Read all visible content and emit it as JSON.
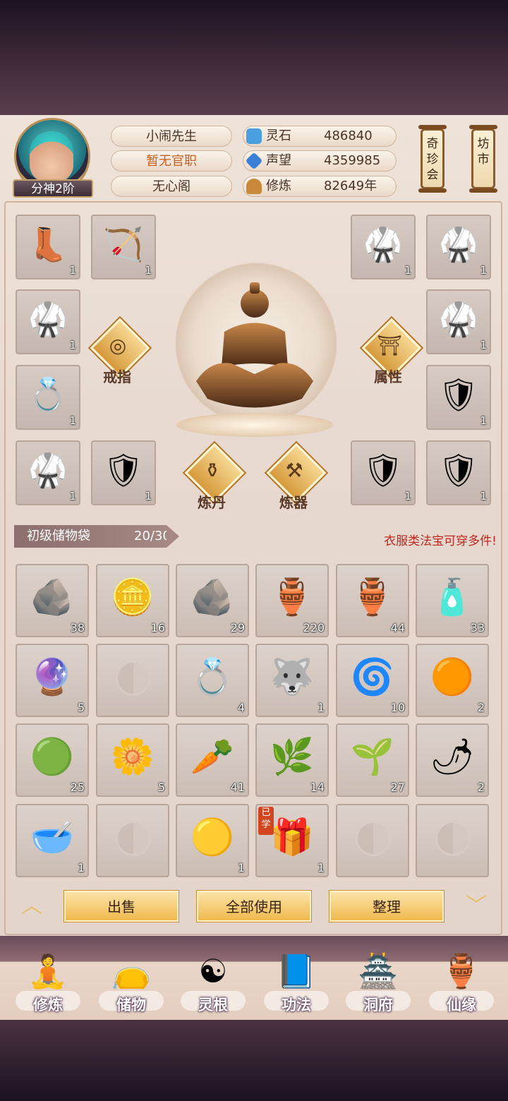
{
  "header": {
    "rank_badge": "分神2阶",
    "player_name": "小闹先生",
    "official_title": "暂无官职",
    "sect": "无心阁",
    "resources": [
      {
        "label": "灵石",
        "value": "486840",
        "icon": "spirit-stone-icon",
        "color": "#4a9fe0"
      },
      {
        "label": "声望",
        "value": "4359985",
        "icon": "crystal-icon",
        "color": "#3b7fd6"
      },
      {
        "label": "修炼",
        "value": "82649年",
        "icon": "meditation-icon",
        "color": "#c88a3a"
      }
    ],
    "side_buttons": [
      {
        "label": "奇珍会"
      },
      {
        "label": "坊市"
      }
    ]
  },
  "equipment": {
    "left_slots": [
      {
        "icon": "boots-icon",
        "glyph": "👢",
        "count": "1"
      },
      {
        "icon": "bow-icon",
        "glyph": "🏹",
        "count": "1"
      },
      {
        "icon": "green-armor-icon",
        "glyph": "🥋",
        "count": "1"
      },
      {
        "icon": "ring-icon",
        "glyph": "💍",
        "count": "1"
      },
      {
        "icon": "green-armor-icon",
        "glyph": "🥋",
        "count": "1"
      },
      {
        "icon": "red-armor-icon",
        "glyph": "🛡",
        "count": "1"
      }
    ],
    "right_slots": [
      {
        "icon": "green-armor-icon",
        "glyph": "🥋",
        "count": "1"
      },
      {
        "icon": "green-armor-icon",
        "glyph": "🥋",
        "count": "1"
      },
      {
        "icon": "green-armor-icon",
        "glyph": "🥋",
        "count": "1"
      },
      {
        "icon": "red-armor-icon",
        "glyph": "🛡",
        "count": "1"
      },
      {
        "icon": "silver-armor-icon",
        "glyph": "🛡",
        "count": "1"
      },
      {
        "icon": "red-armor-icon",
        "glyph": "🛡",
        "count": "1"
      }
    ],
    "functions": {
      "ring": "戒指",
      "attributes": "属性",
      "alchemy": "炼丹",
      "forging": "炼器"
    }
  },
  "bag": {
    "title": "初级储物袋",
    "capacity": "20/30",
    "notice": "衣服类法宝可穿多件!",
    "learned_tag": "已学",
    "items": [
      {
        "icon": "silver-ore-icon",
        "glyph": "🪨",
        "count": "38"
      },
      {
        "icon": "gold-ore-icon",
        "glyph": "🪙",
        "count": "16"
      },
      {
        "icon": "iron-ore-icon",
        "glyph": "🪨",
        "count": "29"
      },
      {
        "icon": "green-gourd-icon",
        "glyph": "🏺",
        "count": "220"
      },
      {
        "icon": "orange-gourd-icon",
        "glyph": "🏺",
        "count": "44"
      },
      {
        "icon": "jade-bottle-icon",
        "glyph": "🧴",
        "count": "33"
      },
      {
        "icon": "star-disc-icon",
        "glyph": "🔮",
        "count": "5"
      },
      {
        "icon": "empty-slot-icon",
        "glyph": "",
        "count": ""
      },
      {
        "icon": "bracelet-icon",
        "glyph": "💍",
        "count": "4"
      },
      {
        "icon": "beast-icon",
        "glyph": "🐺",
        "count": "1"
      },
      {
        "icon": "cloud-scroll-icon",
        "glyph": "🌀",
        "count": "10"
      },
      {
        "icon": "fire-orb-icon",
        "glyph": "🟠",
        "count": "2"
      },
      {
        "icon": "green-orb-icon",
        "glyph": "🟢",
        "count": "25"
      },
      {
        "icon": "white-flower-icon",
        "glyph": "🌼",
        "count": "5"
      },
      {
        "icon": "ginseng-icon",
        "glyph": "🥕",
        "count": "41"
      },
      {
        "icon": "herb-root-icon",
        "glyph": "🌿",
        "count": "14"
      },
      {
        "icon": "flower-herb-icon",
        "glyph": "🌱",
        "count": "27"
      },
      {
        "icon": "red-root-icon",
        "glyph": "🌶",
        "count": "2"
      },
      {
        "icon": "spirit-bowl-icon",
        "glyph": "🥣",
        "count": "1"
      },
      {
        "icon": "empty-slot-icon",
        "glyph": "",
        "count": ""
      },
      {
        "icon": "yellow-orb-icon",
        "glyph": "🟡",
        "count": "1"
      },
      {
        "icon": "treasure-gourd-icon",
        "glyph": "🎁",
        "count": "1",
        "learned": true
      },
      {
        "icon": "empty-slot-icon",
        "glyph": "",
        "count": ""
      },
      {
        "icon": "empty-slot-icon",
        "glyph": "",
        "count": ""
      }
    ]
  },
  "actions": {
    "sell": "出售",
    "use_all": "全部使用",
    "sort": "整理",
    "prev_arrow": "︿",
    "next_arrow": "﹀"
  },
  "bottom_nav": [
    {
      "label": "修炼",
      "icon": "cultivation-icon",
      "glyph": "🧘"
    },
    {
      "label": "储物",
      "icon": "storage-bag-icon",
      "glyph": "👝"
    },
    {
      "label": "灵根",
      "icon": "spirit-root-icon",
      "glyph": "☯"
    },
    {
      "label": "功法",
      "icon": "technique-book-icon",
      "glyph": "📘"
    },
    {
      "label": "洞府",
      "icon": "cave-dwelling-icon",
      "glyph": "🏯"
    },
    {
      "label": "仙缘",
      "icon": "immortal-fate-icon",
      "glyph": "🏺"
    }
  ]
}
